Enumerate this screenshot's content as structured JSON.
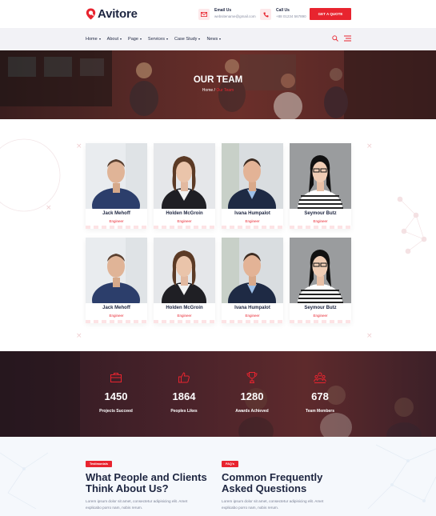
{
  "brand": {
    "name": "Avitore",
    "accent": "#e8242f",
    "dark": "#1d2540"
  },
  "header": {
    "email": {
      "label": "Email Us",
      "value": "websitename@gmail.com"
    },
    "phone": {
      "label": "Call Us",
      "value": "+88 01234 567890"
    },
    "cta": "GET A QUOTE"
  },
  "nav": {
    "items": [
      {
        "label": "Home"
      },
      {
        "label": "About"
      },
      {
        "label": "Page"
      },
      {
        "label": "Services"
      },
      {
        "label": "Case Study"
      },
      {
        "label": "News"
      }
    ]
  },
  "hero": {
    "title": "OUR TEAM",
    "crumb_home": "Home",
    "crumb_sep": "/",
    "crumb_current": "Our Team"
  },
  "team": [
    {
      "name": "Jack Mehoff",
      "role": "Engineer"
    },
    {
      "name": "Holden McGroin",
      "role": "Engineer"
    },
    {
      "name": "Ivana Humpalot",
      "role": "Engineer"
    },
    {
      "name": "Seymour Butz",
      "role": "Engineer"
    },
    {
      "name": "Jack Mehoff",
      "role": "Engineer"
    },
    {
      "name": "Holden McGroin",
      "role": "Engineer"
    },
    {
      "name": "Ivana Humpalot",
      "role": "Engineer"
    },
    {
      "name": "Seymour Butz",
      "role": "Engineer"
    }
  ],
  "stats": [
    {
      "value": "1450",
      "label": "Projects Succeed",
      "icon": "briefcase-icon"
    },
    {
      "value": "1864",
      "label": "Peoples Likes",
      "icon": "thumbs-up-icon"
    },
    {
      "value": "1280",
      "label": "Awards Achieved",
      "icon": "trophy-icon"
    },
    {
      "value": "678",
      "label": "Team Members",
      "icon": "team-icon"
    }
  ],
  "testimonials": {
    "tag": "Testimonials",
    "title_line1": "What People and Clients",
    "title_line2": "Think About Us?",
    "text_line1": "Lorem ipsum dolor sit amet, consectetur adipisicing elit. Amet",
    "text_line2": "explicabo porro nam, nobis rerum."
  },
  "faq": {
    "tag": "FAQ's",
    "title_line1": "Common Frequently",
    "title_line2": "Asked Questions",
    "text_line1": "Lorem ipsum dolor sit amet, consectetur adipisicing elit. Amet",
    "text_line2": "explicabo porro nam, nobis rerum."
  }
}
